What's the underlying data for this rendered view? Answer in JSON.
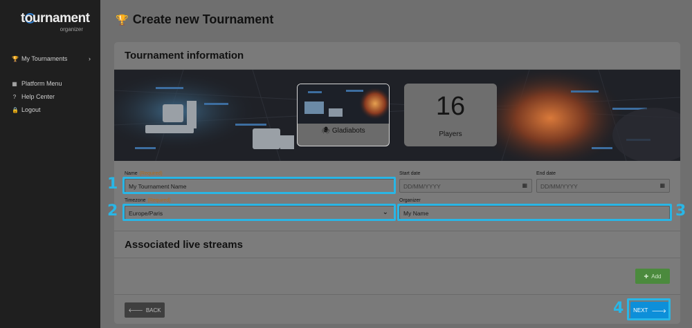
{
  "sidebar": {
    "logo": {
      "main": "tournament",
      "sub": "organizer"
    },
    "items": [
      {
        "label": "My Tournaments",
        "icon": "trophy-icon"
      },
      {
        "label": "Platform Menu",
        "icon": "grid-icon"
      },
      {
        "label": "Help Center",
        "icon": "question-icon"
      },
      {
        "label": "Logout",
        "icon": "lock-icon"
      }
    ]
  },
  "page": {
    "title": "Create new Tournament"
  },
  "card": {
    "title": "Tournament information",
    "game": {
      "name": "Gladiabots"
    },
    "players": {
      "count": "16",
      "label": "Players"
    }
  },
  "form": {
    "name": {
      "label": "Name",
      "required": "(Required)",
      "value": "My Tournament Name"
    },
    "start_date": {
      "label": "Start date",
      "placeholder": "DD/MM/YYYY"
    },
    "end_date": {
      "label": "End date",
      "placeholder": "DD/MM/YYYY"
    },
    "timezone": {
      "label": "Timezone",
      "required": "(Required)",
      "value": "Europe/Paris"
    },
    "organizer": {
      "label": "Organizer",
      "value": "My Name"
    }
  },
  "streams": {
    "title": "Associated live streams",
    "add_label": "Add"
  },
  "footer": {
    "back_label": "BACK",
    "next_label": "NEXT"
  },
  "annotations": [
    "1",
    "2",
    "3",
    "4"
  ],
  "colors": {
    "highlight": "#29b6e6",
    "add_button": "#4b8a3d",
    "next_button": "#0d8fd9"
  }
}
